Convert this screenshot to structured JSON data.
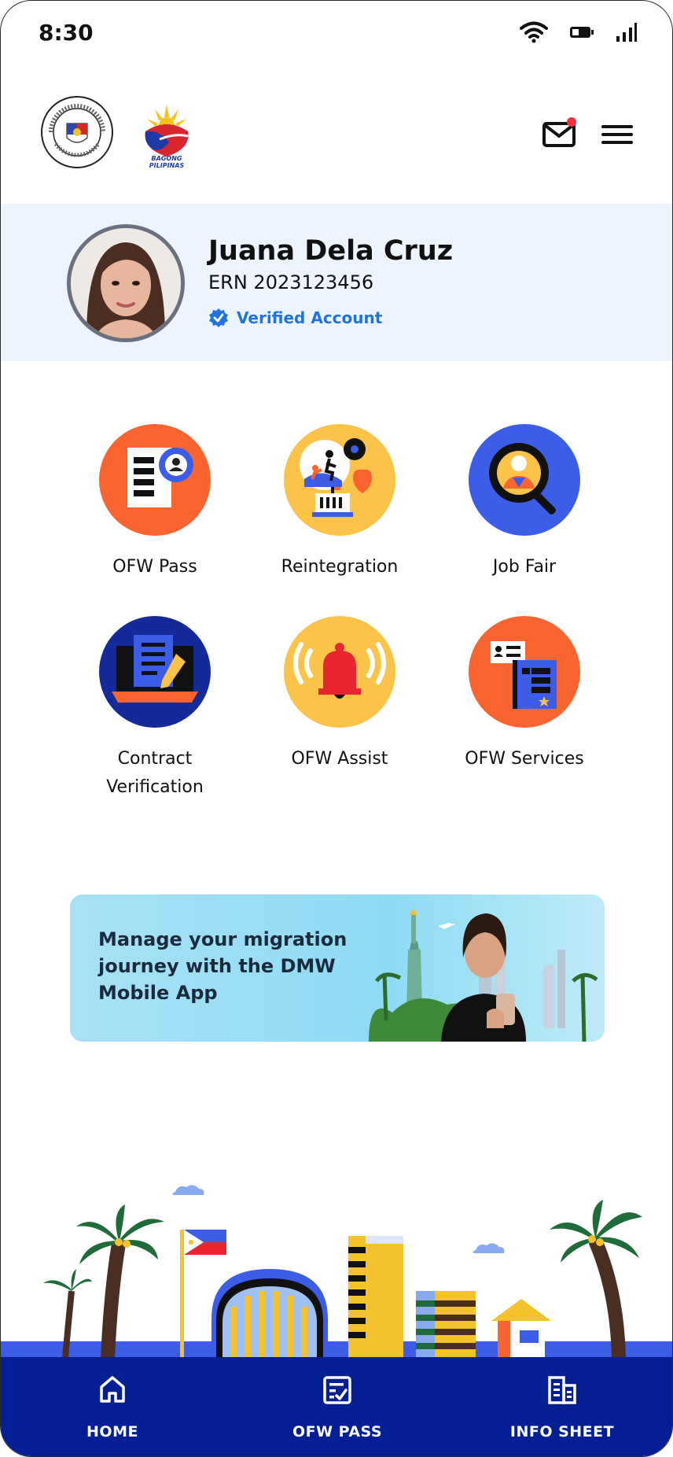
{
  "status_bar": {
    "time": "8:30"
  },
  "header": {
    "logo_dmw": "dmw-seal-icon",
    "logo_bagong_pilipinas": "bagong-pilipinas-logo",
    "bagong_pilipinas_text": "BAGONG PILIPINAS",
    "mail_icon": "mail-icon",
    "mail_has_notification": true,
    "menu_icon": "hamburger-menu-icon"
  },
  "profile": {
    "name": "Juana Dela Cruz",
    "ern": "ERN 2023123456",
    "verified_label": "Verified Account"
  },
  "services": [
    {
      "label": "OFW Pass",
      "icon": "ofw-pass-icon",
      "color": "#f96431"
    },
    {
      "label": "Reintegration",
      "icon": "reintegration-icon",
      "color": "#fcc34a"
    },
    {
      "label": "Job Fair",
      "icon": "job-fair-icon",
      "color": "#3c5de8"
    },
    {
      "label": "Contract Verification",
      "icon": "contract-verification-icon",
      "color": "#132a98"
    },
    {
      "label": "OFW Assist",
      "icon": "ofw-assist-icon",
      "color": "#fcc34a"
    },
    {
      "label": "OFW Services",
      "icon": "ofw-services-icon",
      "color": "#f96431"
    }
  ],
  "banner": {
    "text": "Manage your migration journey with the DMW Mobile App"
  },
  "bottom_nav": [
    {
      "label": "HOME",
      "icon": "home-icon"
    },
    {
      "label": "OFW PASS",
      "icon": "checklist-icon"
    },
    {
      "label": "INFO SHEET",
      "icon": "building-icon"
    }
  ],
  "colors": {
    "nav_bg": "#041e93",
    "profile_bg": "#eef4fd",
    "verified": "#1f74e0"
  }
}
